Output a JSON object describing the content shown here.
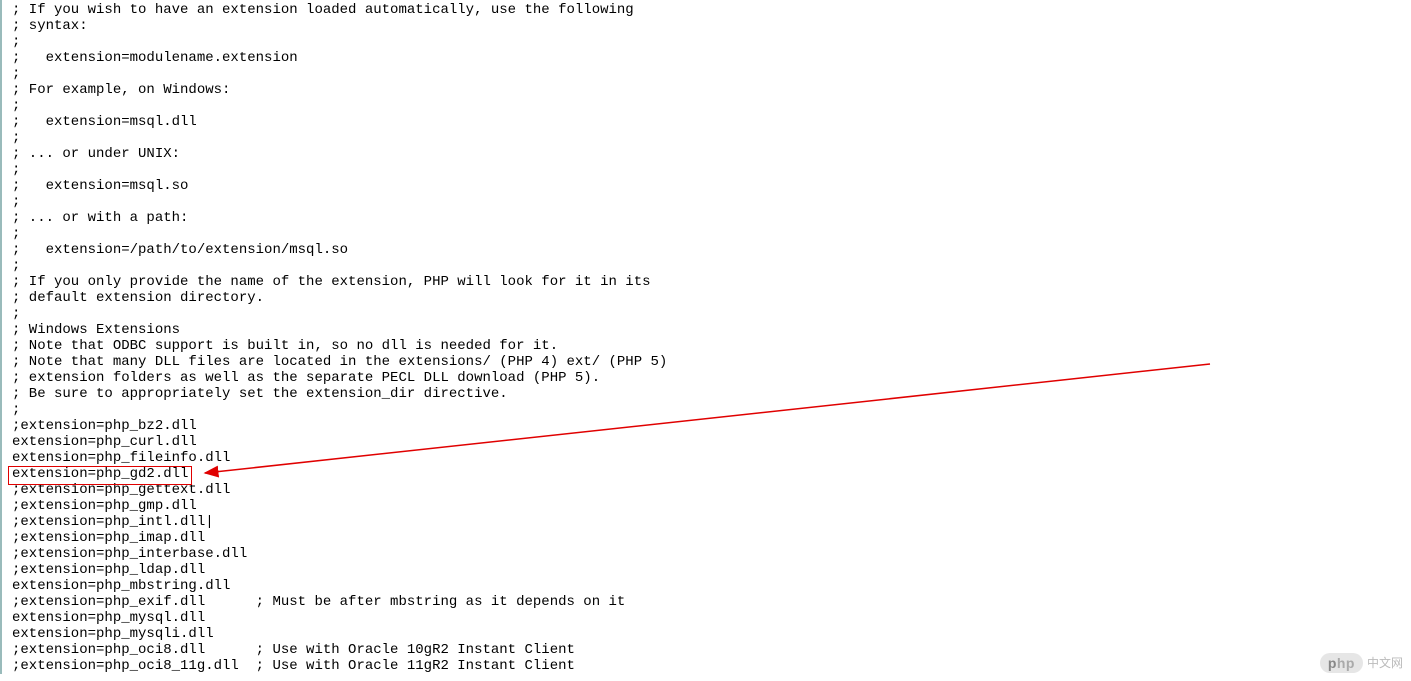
{
  "lines": [
    "; If you wish to have an extension loaded automatically, use the following",
    "; syntax:",
    ";",
    ";   extension=modulename.extension",
    ";",
    "; For example, on Windows:",
    ";",
    ";   extension=msql.dll",
    ";",
    "; ... or under UNIX:",
    ";",
    ";   extension=msql.so",
    ";",
    "; ... or with a path:",
    ";",
    ";   extension=/path/to/extension/msql.so",
    ";",
    "; If you only provide the name of the extension, PHP will look for it in its",
    "; default extension directory.",
    ";",
    "; Windows Extensions",
    "; Note that ODBC support is built in, so no dll is needed for it.",
    "; Note that many DLL files are located in the extensions/ (PHP 4) ext/ (PHP 5)",
    "; extension folders as well as the separate PECL DLL download (PHP 5).",
    "; Be sure to appropriately set the extension_dir directive.",
    ";",
    ";extension=php_bz2.dll",
    "extension=php_curl.dll",
    "extension=php_fileinfo.dll",
    "extension=php_gd2.dll",
    ";extension=php_gettext.dll",
    ";extension=php_gmp.dll",
    ";extension=php_intl.dll|",
    ";extension=php_imap.dll",
    ";extension=php_interbase.dll",
    ";extension=php_ldap.dll",
    "extension=php_mbstring.dll",
    ";extension=php_exif.dll      ; Must be after mbstring as it depends on it",
    "extension=php_mysql.dll",
    "extension=php_mysqli.dll",
    ";extension=php_oci8.dll      ; Use with Oracle 10gR2 Instant Client",
    ";extension=php_oci8_11g.dll  ; Use with Oracle 11gR2 Instant Client"
  ],
  "highlighted_line_index": 29,
  "watermark": {
    "badge_bold": "p",
    "badge_rest": "hp",
    "text": "中文网"
  }
}
